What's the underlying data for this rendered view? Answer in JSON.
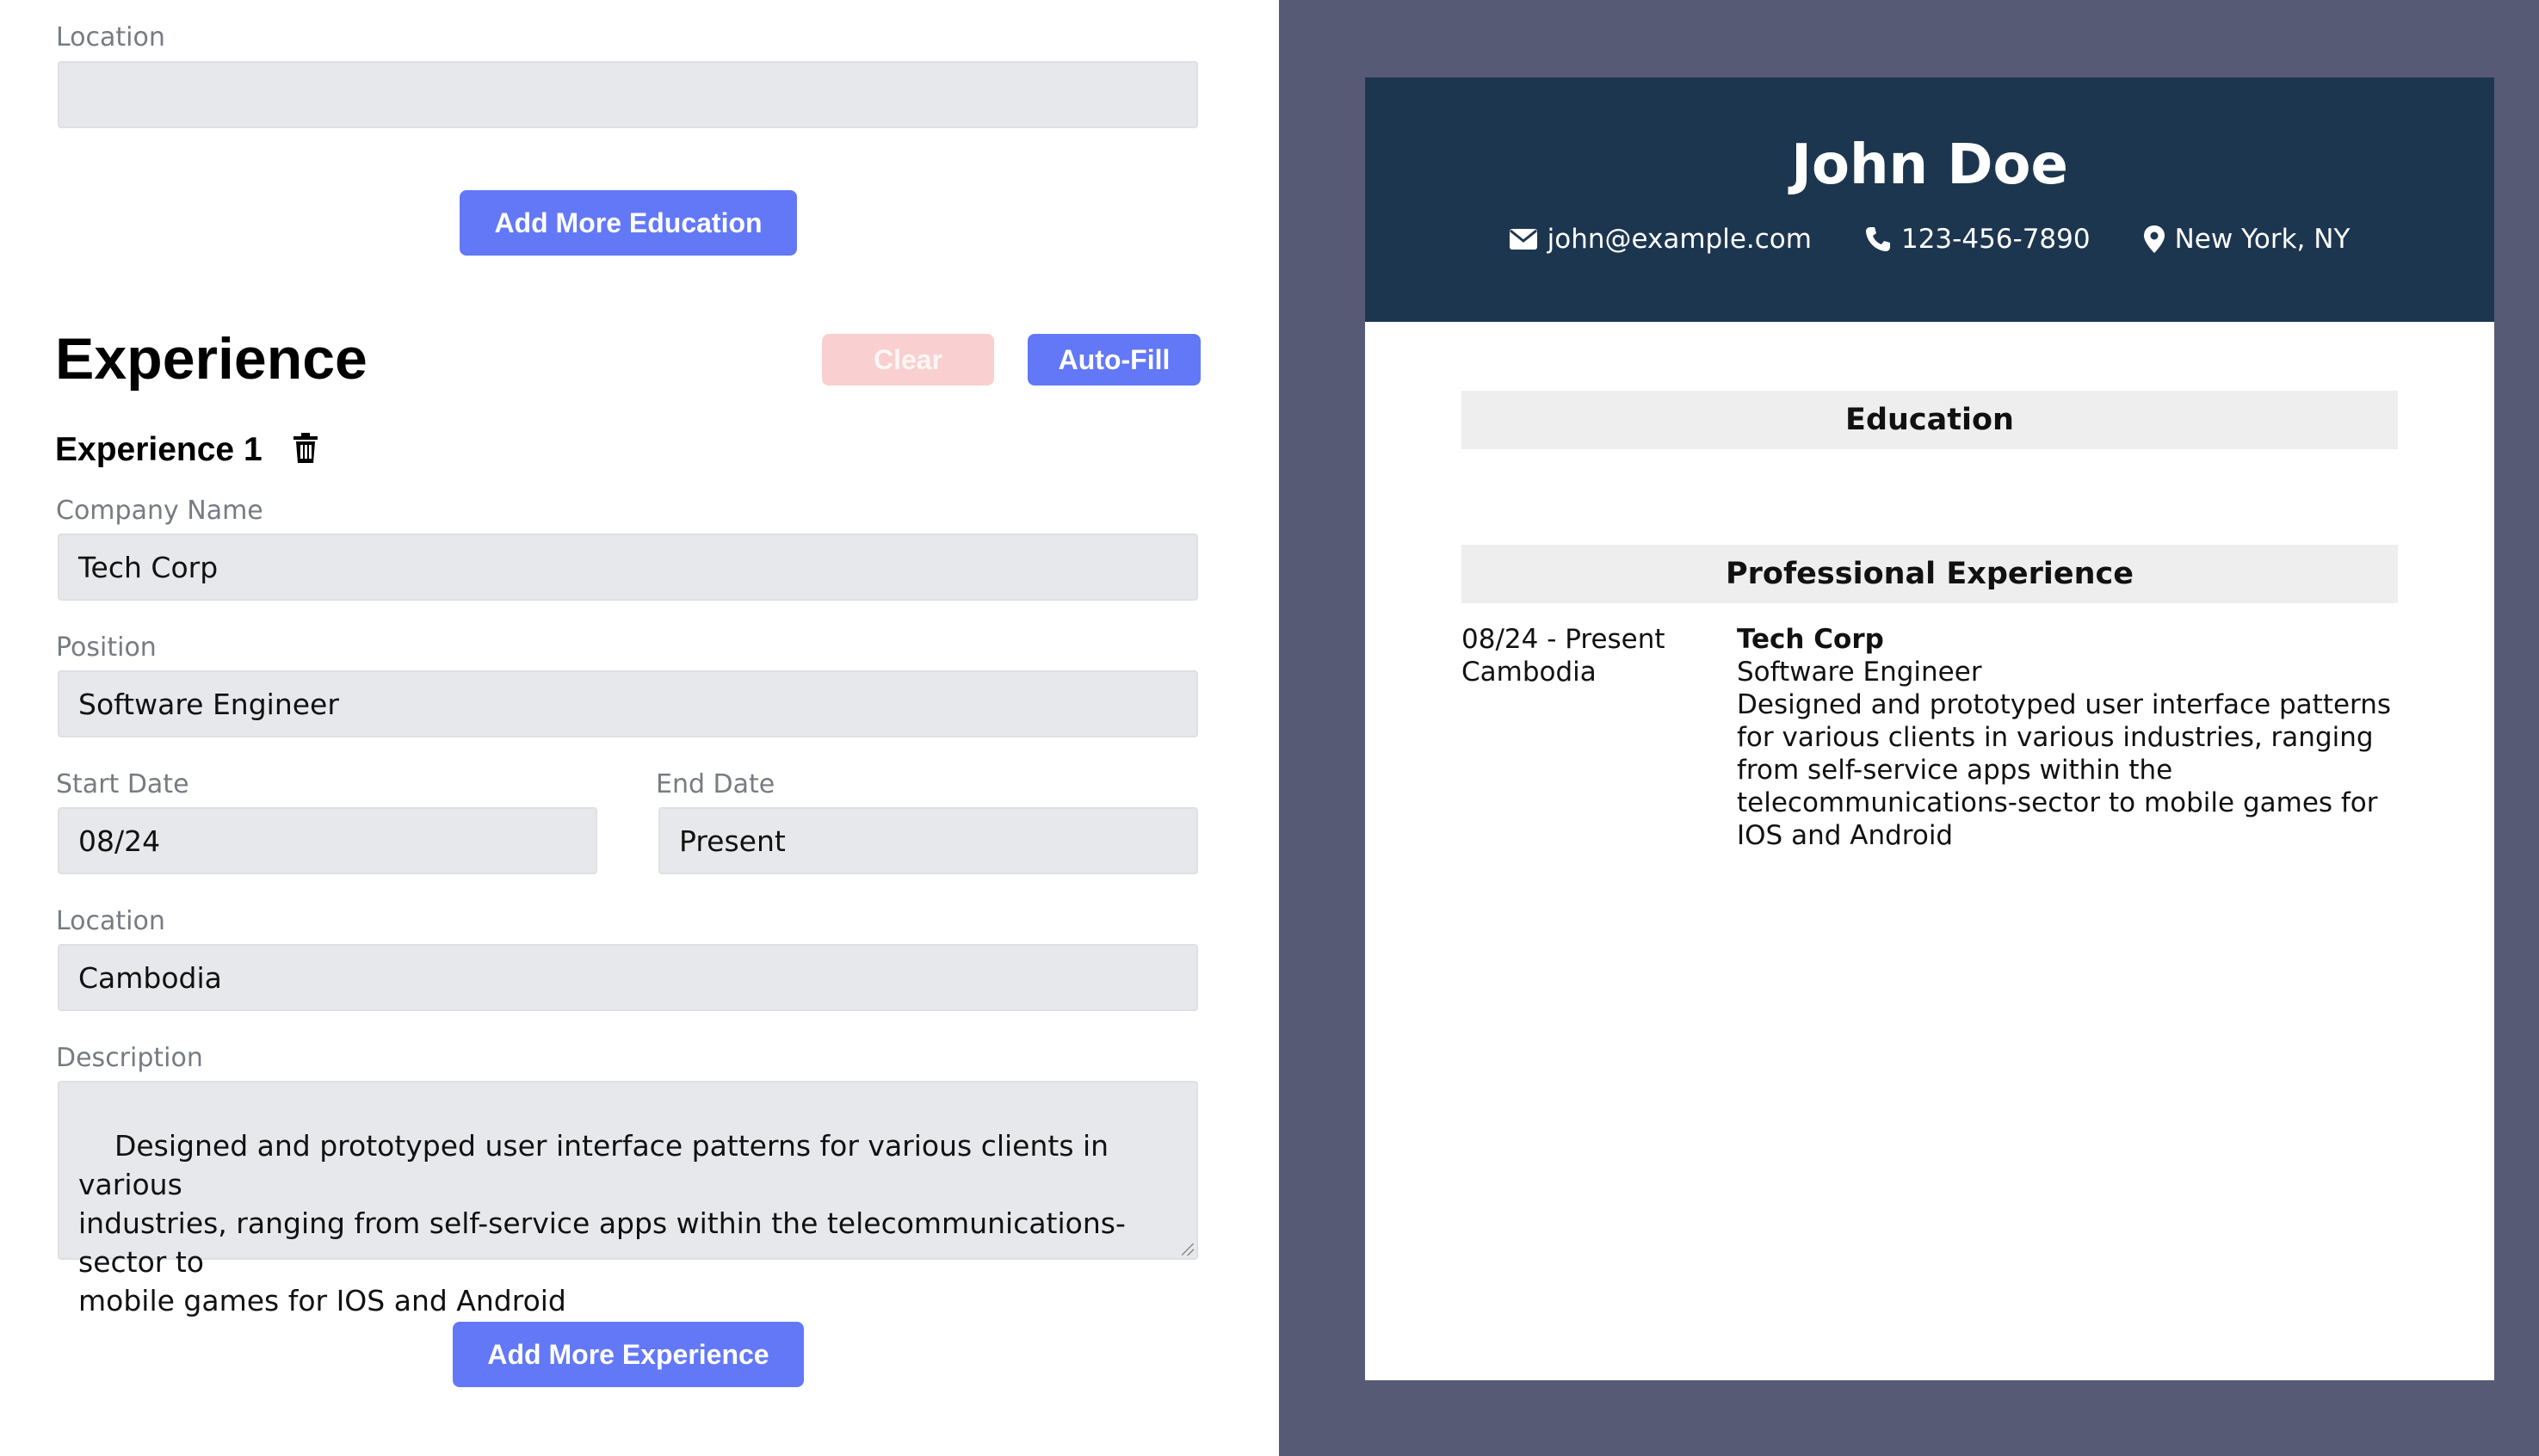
{
  "editor": {
    "education_location": {
      "label": "Location",
      "value": ""
    },
    "add_education_label": "Add More Education",
    "experience_heading": "Experience",
    "clear_label": "Clear",
    "autofill_label": "Auto-Fill",
    "entry_title": "Experience 1",
    "company": {
      "label": "Company Name",
      "value": "Tech Corp"
    },
    "position": {
      "label": "Position",
      "value": "Software Engineer"
    },
    "start_date": {
      "label": "Start Date",
      "value": "08/24"
    },
    "end_date": {
      "label": "End Date",
      "value": "Present"
    },
    "location": {
      "label": "Location",
      "value": "Cambodia"
    },
    "description": {
      "label": "Description",
      "value": "Designed and prototyped user interface patterns for various clients in various\nindustries, ranging from self-service apps within the telecommunications-sector to\nmobile games for IOS and Android"
    },
    "add_experience_label": "Add More Experience",
    "colors": {
      "accent": "#6378f7",
      "clear": "#f9cfcf",
      "field_bg": "#e7e8eb"
    }
  },
  "resume": {
    "name": "John Doe",
    "email": "john@example.com",
    "phone": "123-456-7890",
    "location": "New York, NY",
    "icons": [
      "envelope-icon",
      "phone-icon",
      "map-pin-icon"
    ],
    "education_heading": "Education",
    "education_placeholder": "-",
    "experience_heading": "Professional Experience",
    "experience": {
      "dates": "08/24 - Present",
      "location": "Cambodia",
      "company": "Tech Corp",
      "position": "Software Engineer",
      "description": "Designed and prototyped user interface patterns\nfor various clients in various industries, ranging\nfrom self-service apps within the\ntelecommunications-sector to mobile games for\nIOS and Android"
    },
    "colors": {
      "header_bg": "#1d3650",
      "backdrop": "#575a75",
      "section_bar": "#eeeeee"
    }
  }
}
